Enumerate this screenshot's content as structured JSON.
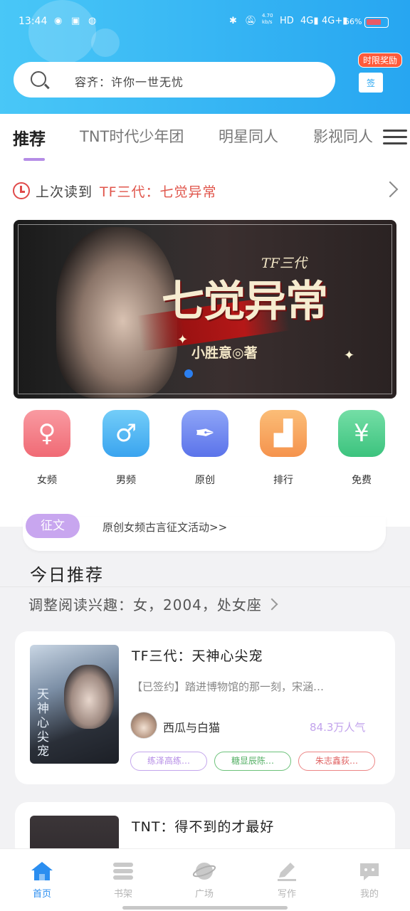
{
  "status_bar": {
    "time": "13:44",
    "net_speed": "4.70\nkb/s",
    "battery": "66%"
  },
  "search": {
    "placeholder": "容齐：许你一世无忧"
  },
  "gift": {
    "badge": "时限奖励",
    "box_label": "签"
  },
  "tabs": [
    {
      "label": "推荐",
      "active": true
    },
    {
      "label": "TNT时代少年团",
      "active": false
    },
    {
      "label": "明星同人",
      "active": false
    },
    {
      "label": "影视同人",
      "active": false
    }
  ],
  "last_read": {
    "label": "上次读到",
    "title": "TF三代：七觉异常"
  },
  "banner": {
    "series": "TF三代",
    "title": "七觉异常",
    "author": "小胜意◎著"
  },
  "quick_nav": [
    {
      "label": "女频",
      "icon": "female-icon",
      "color": "#f47d86"
    },
    {
      "label": "男频",
      "icon": "male-icon",
      "color": "#48b4f2"
    },
    {
      "label": "原创",
      "icon": "pen-nib-icon",
      "color": "#6d86ef"
    },
    {
      "label": "排行",
      "icon": "podium-icon",
      "color": "#f7a35e"
    },
    {
      "label": "免费",
      "icon": "yen-icon",
      "color": "#52cf8e"
    }
  ],
  "event": {
    "tag": "征文",
    "text": "原创女频古言征文活动>>"
  },
  "today": {
    "title": "今日推荐",
    "adjust": "调整阅读兴趣：女，2004，处女座"
  },
  "books": [
    {
      "title": "TF三代：天神心尖宠",
      "desc": "【已签约】踏进博物馆的那一刻，宋涵…",
      "author": "西瓜与白猫",
      "popularity": "84.3万人气",
      "cover_text": "天神心尖宠",
      "tags": [
        "练泽高练…",
        "糖显辰陈…",
        "朱志鑫荻…"
      ]
    },
    {
      "title": "TNT：得不到的才最好"
    }
  ],
  "bottom_nav": [
    {
      "label": "首页",
      "icon": "home-icon",
      "active": true
    },
    {
      "label": "书架",
      "icon": "bookshelf-icon",
      "active": false
    },
    {
      "label": "广场",
      "icon": "planet-icon",
      "active": false
    },
    {
      "label": "写作",
      "icon": "write-icon",
      "active": false
    },
    {
      "label": "我的",
      "icon": "profile-chat-icon",
      "active": false
    }
  ]
}
